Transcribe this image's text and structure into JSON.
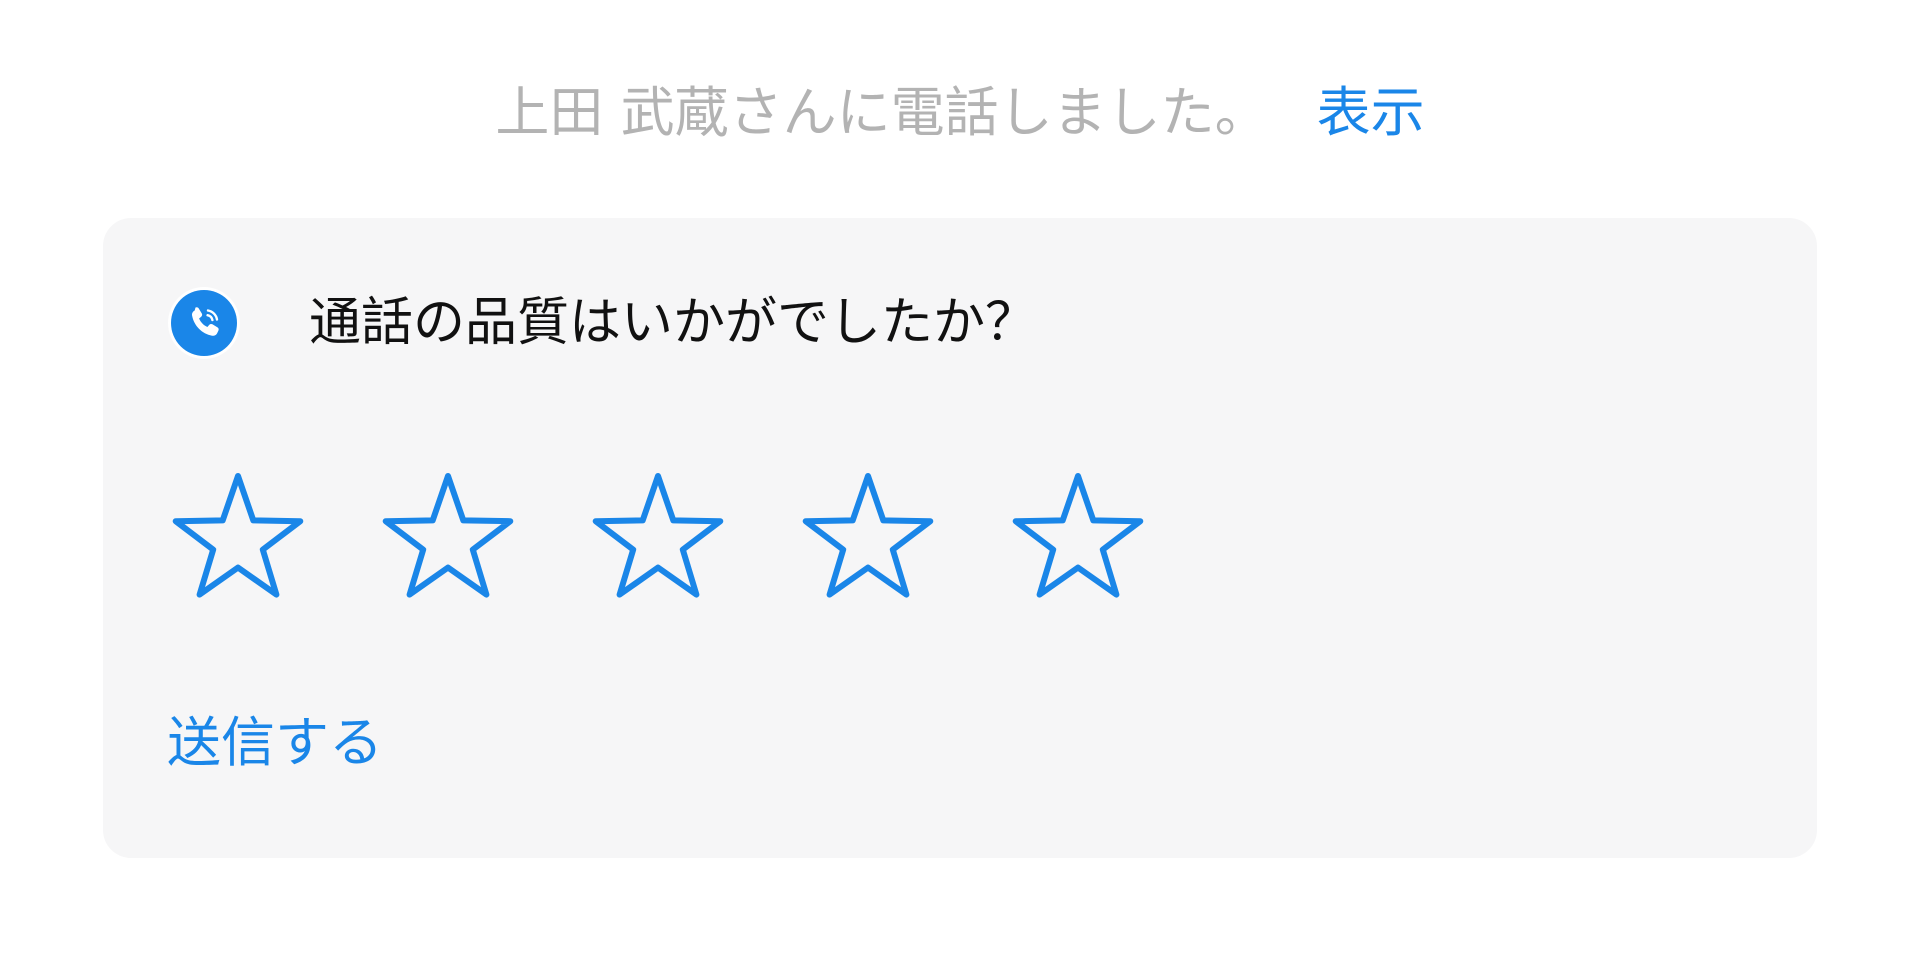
{
  "notice": {
    "text": "上田 武蔵さんに電話しました。",
    "view_link": "表示"
  },
  "rating_card": {
    "icon": "phone-icon",
    "question": "通話の品質はいかがでしたか？",
    "rating": {
      "value": 0,
      "max": 5
    },
    "submit_label": "送信する"
  },
  "colors": {
    "accent": "#1a86e8",
    "muted_text": "#b3b3b3",
    "card_background": "#f6f6f7"
  }
}
